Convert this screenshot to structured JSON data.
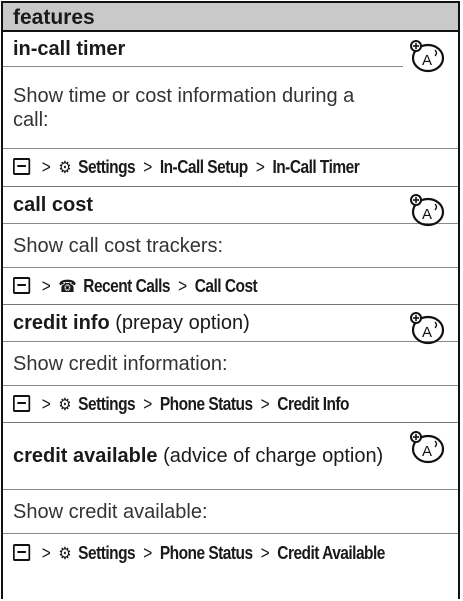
{
  "header": {
    "title": "features"
  },
  "features": [
    {
      "title": "in-call timer",
      "note": "",
      "desc": "Show time or cost information during a call:",
      "path": [
        "In-Call Setup",
        "In-Call Timer"
      ],
      "path_icon": "settings-icon",
      "path_first": "Settings"
    },
    {
      "title": "call cost",
      "note": "",
      "desc": "Show call cost trackers:",
      "path": [
        "Call Cost"
      ],
      "path_icon": "recent-calls-icon",
      "path_first": "Recent Calls"
    },
    {
      "title": "credit info",
      "note": "(prepay option)",
      "desc": "Show credit information:",
      "path": [
        "Phone Status",
        "Credit Info"
      ],
      "path_icon": "settings-icon",
      "path_first": "Settings"
    },
    {
      "title": "credit available",
      "note": "(advice of charge option)",
      "desc": "Show credit available:",
      "path": [
        "Phone Status",
        "Credit Available"
      ],
      "path_icon": "settings-icon",
      "path_first": "Settings"
    }
  ],
  "symbols": {
    "separator": ">",
    "network_badge": "network-dependent-feature-icon"
  }
}
